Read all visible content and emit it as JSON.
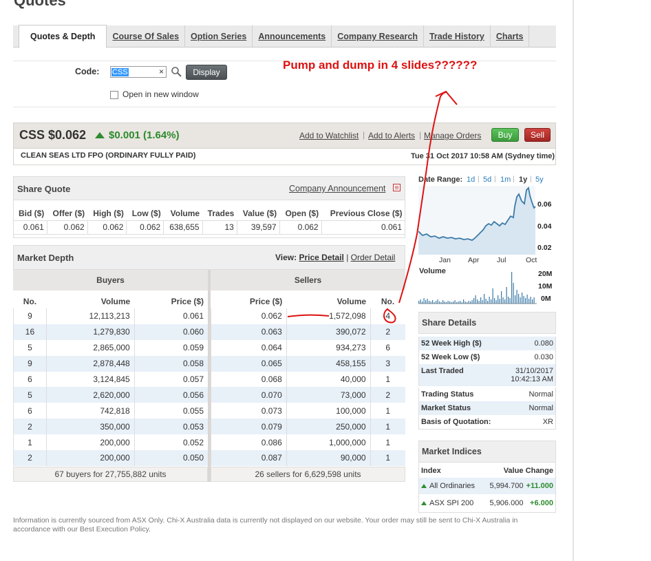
{
  "page": {
    "title": "Quotes"
  },
  "tabs": [
    {
      "label": "Quotes & Depth"
    },
    {
      "label": "Course Of Sales"
    },
    {
      "label": "Option Series"
    },
    {
      "label": "Announcements"
    },
    {
      "label": "Company Research"
    },
    {
      "label": "Trade History"
    },
    {
      "label": "Charts"
    }
  ],
  "form": {
    "code_label": "Code:",
    "code_value": "CSS",
    "clear_glyph": "×",
    "display_label": "Display",
    "new_window_label": "Open in new window"
  },
  "annotation": {
    "text": "Pump and dump in 4 slides??????",
    "color": "#dd1111"
  },
  "quote": {
    "symbol_price": "CSS $0.062",
    "change": "$0.001 (1.64%)",
    "links": [
      "Add to Watchlist",
      "Add to Alerts",
      "Manage Orders"
    ],
    "separator": "|",
    "buy_label": "Buy",
    "sell_label": "Sell",
    "company": "CLEAN SEAS LTD FPO (ORDINARY FULLY PAID)",
    "datetime": "Tue 31 Oct 2017 10:58 AM (Sydney time)",
    "colors": {
      "up": "#2b8a2b",
      "buy": "#3b9a3b",
      "sell": "#a12622"
    }
  },
  "share_quote": {
    "title": "Share Quote",
    "announcement_link": "Company Announcement",
    "headers": [
      "Bid ($)",
      "Offer ($)",
      "High ($)",
      "Low ($)",
      "Volume",
      "Trades",
      "Value ($)",
      "Open ($)",
      "Previous Close ($)"
    ],
    "values": [
      "0.061",
      "0.062",
      "0.062",
      "0.062",
      "638,655",
      "13",
      "39,597",
      "0.062",
      "0.061"
    ]
  },
  "market_depth": {
    "title": "Market Depth",
    "view_label": "View:",
    "price_detail": "Price Detail",
    "view_sep": "|",
    "order_detail": "Order Detail",
    "buyers_title": "Buyers",
    "sellers_title": "Sellers",
    "buyer_headers": [
      "No.",
      "Volume",
      "Price ($)"
    ],
    "seller_headers": [
      "Price ($)",
      "Volume",
      "No."
    ],
    "buyers": [
      [
        "9",
        "12,113,213",
        "0.061"
      ],
      [
        "16",
        "1,279,830",
        "0.060"
      ],
      [
        "5",
        "2,865,000",
        "0.059"
      ],
      [
        "9",
        "2,878,448",
        "0.058"
      ],
      [
        "6",
        "3,124,845",
        "0.057"
      ],
      [
        "5",
        "2,620,000",
        "0.056"
      ],
      [
        "6",
        "742,818",
        "0.055"
      ],
      [
        "2",
        "350,000",
        "0.053"
      ],
      [
        "1",
        "200,000",
        "0.052"
      ],
      [
        "2",
        "200,000",
        "0.050"
      ]
    ],
    "sellers": [
      [
        "0.062",
        "1,572,098",
        "4"
      ],
      [
        "0.063",
        "390,072",
        "2"
      ],
      [
        "0.064",
        "934,273",
        "6"
      ],
      [
        "0.065",
        "458,155",
        "3"
      ],
      [
        "0.068",
        "40,000",
        "1"
      ],
      [
        "0.070",
        "73,000",
        "2"
      ],
      [
        "0.073",
        "100,000",
        "1"
      ],
      [
        "0.079",
        "250,000",
        "1"
      ],
      [
        "0.086",
        "1,000,000",
        "1"
      ],
      [
        "0.087",
        "90,000",
        "1"
      ]
    ],
    "buyers_summary": "67 buyers for 27,755,882 units",
    "sellers_summary": "26 sellers for 6,629,598 units"
  },
  "chart": {
    "date_range_label": "Date Range:",
    "ranges": [
      "1d",
      "5d",
      "1m",
      "1y",
      "5y"
    ],
    "active_range": "1y",
    "range_sep": "|",
    "y_ticks": [
      "0.06",
      "0.04",
      "0.02"
    ],
    "x_ticks": [
      "Jan",
      "Apr",
      "Jul",
      "Oct"
    ],
    "volume_label": "Volume",
    "volume_ticks": [
      "20M",
      "10M",
      "0M"
    ],
    "line_color": "#3a7aa8"
  },
  "share_details": {
    "title": "Share Details",
    "rows": [
      {
        "k": "52 Week High ($)",
        "v": "0.080"
      },
      {
        "k": "52 Week Low ($)",
        "v": "0.030"
      },
      {
        "k": "Last Traded",
        "v": "31/10/2017",
        "v2": "10:42:13 AM"
      },
      {
        "k": "Trading Status",
        "v": "Normal"
      },
      {
        "k": "Market Status",
        "v": "Normal"
      },
      {
        "k": "Basis of Quotation:",
        "v": "XR"
      }
    ]
  },
  "market_indices": {
    "title": "Market Indices",
    "headers": [
      "Index",
      "Value",
      "Change"
    ],
    "rows": [
      {
        "name": "All Ordinaries",
        "value": "5,994.700",
        "change": "+11.000"
      },
      {
        "name": "ASX SPI 200",
        "value": "5,906.000",
        "change": "+6.000"
      }
    ]
  },
  "footer": {
    "text": "Information is currently sourced from ASX Only. Chi-X Australia data is currently not displayed on our website. Your order may still be sent to Chi-X Australia in accordance with our Best Execution Policy."
  }
}
